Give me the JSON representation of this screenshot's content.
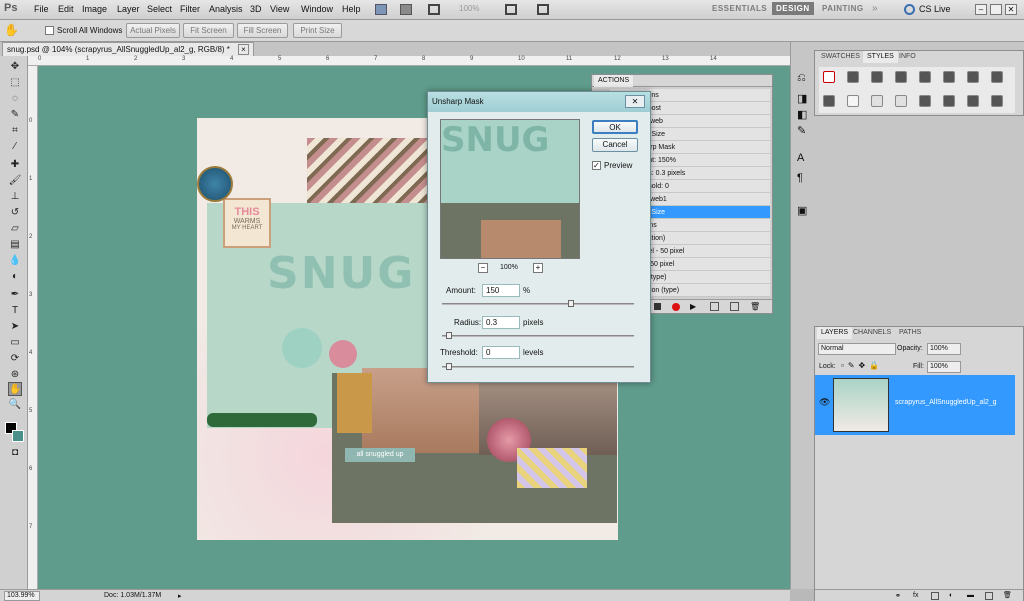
{
  "app": {
    "logo": "Ps",
    "menus": [
      "File",
      "Edit",
      "Image",
      "Layer",
      "Select",
      "Filter",
      "Analysis",
      "3D",
      "View",
      "Window",
      "Help"
    ],
    "zoom": "100%",
    "workspaces": [
      "ESSENTIALS",
      "DESIGN",
      "PAINTING"
    ],
    "cs_live": "CS Live"
  },
  "options": {
    "scroll_all_label": "Scroll All Windows",
    "buttons": [
      "Actual Pixels",
      "Fit Screen",
      "Fill Screen",
      "Print Size"
    ]
  },
  "document": {
    "tab_title": "snug.psd @ 104% (scrapyrus_AllSnuggledUp_al2_g, RGB/8) *",
    "ruler_top": [
      "0",
      "1",
      "2",
      "3",
      "4",
      "5",
      "6",
      "7",
      "8",
      "9",
      "10",
      "11",
      "12",
      "13",
      "14"
    ],
    "ruler_left": [
      "0",
      "1",
      "2",
      "3",
      "4",
      "5",
      "6",
      "7"
    ]
  },
  "status": {
    "zoom": "103.99%",
    "doc": "Doc: 1.03M/1.37M"
  },
  "actions_panel": {
    "title": "ACTIONS",
    "rows": [
      {
        "label": "Peach's actions",
        "sel": false
      },
      {
        "label": "harp Light Boost",
        "sel": false
      },
      {
        "label": "mallerize for web",
        "sel": false
      },
      {
        "label": "Image Size",
        "sel": false
      },
      {
        "label": "Unsharp Mask",
        "sel": false
      },
      {
        "label": "Amount: 150%",
        "sel": false
      },
      {
        "label": "Radius: 0.3 pixels",
        "sel": false
      },
      {
        "label": "Threshold: 0",
        "sel": false
      },
      {
        "label": "mallerize for web1",
        "sel": false
      },
      {
        "label": "Image Size",
        "sel": true
      },
      {
        "label": "Default Actions",
        "sel": false
      },
      {
        "label": "ignette (selection)",
        "sel": false
      },
      {
        "label": "rame Channel - 50 pixel",
        "sel": false
      },
      {
        "label": "ood Frame - 50 pixel",
        "sel": false
      },
      {
        "label": "ast Shadow (type)",
        "sel": false
      },
      {
        "label": "Vater Reflection (type)",
        "sel": false
      }
    ]
  },
  "dialog": {
    "title": "Unsharp Mask",
    "ok": "OK",
    "cancel": "Cancel",
    "preview_label": "Preview",
    "preview_checked": true,
    "zoom": "100%",
    "amount_label": "Amount:",
    "amount": "150",
    "amount_unit": "%",
    "radius_label": "Radius:",
    "radius": "0.3",
    "radius_unit": "pixels",
    "threshold_label": "Threshold:",
    "threshold": "0",
    "threshold_unit": "levels",
    "amount_pos": 0.68,
    "radius_pos": 0.02,
    "threshold_pos": 0.02
  },
  "swatch_panel": {
    "tabs": [
      "SWATCHES",
      "STYLES",
      "INFO"
    ]
  },
  "layers_panel": {
    "tabs": [
      "LAYERS",
      "CHANNELS",
      "PATHS"
    ],
    "blend_mode": "Normal",
    "opacity_label": "Opacity:",
    "opacity": "100%",
    "lock_label": "Lock:",
    "fill_label": "Fill:",
    "fill": "100%",
    "layer_name": "scrapyrus_AllSnuggledUp_al2_g"
  },
  "artwork": {
    "title": "SNUG",
    "tag_line1": "THIS",
    "tag_line2": "WARMS",
    "tag_line3": "MY HEART",
    "label": "all snuggled up"
  },
  "colors": {
    "canvas": "#5f9c8c",
    "selection": "#3399ff",
    "dialog_title": "#b9dfe3"
  }
}
